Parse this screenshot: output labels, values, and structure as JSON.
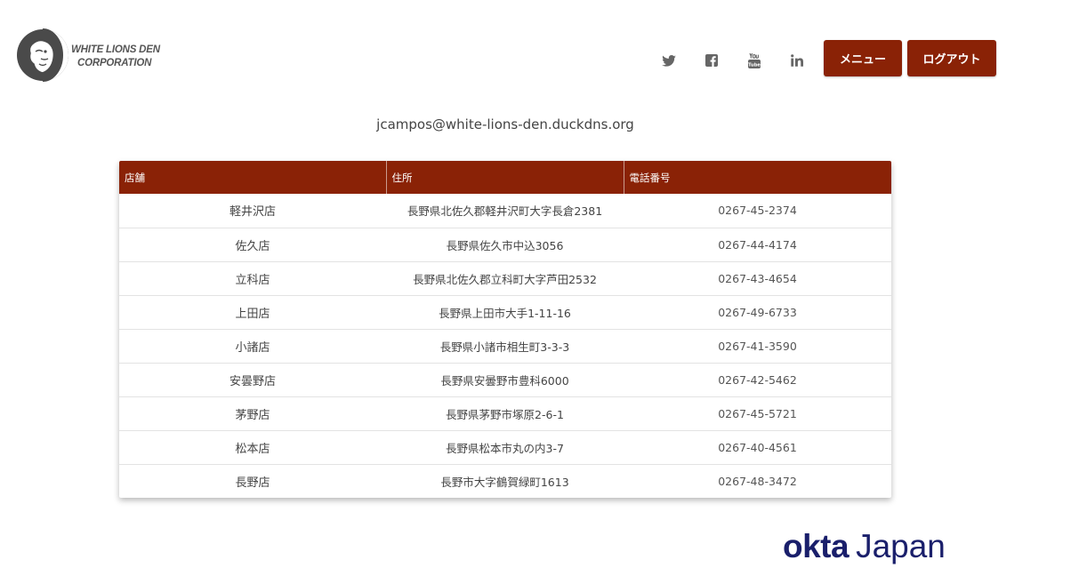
{
  "logo": {
    "line1": "WHITE LIONS DEN",
    "line2": "CORPORATION",
    "icon": "lion-head-logo"
  },
  "social_icons": [
    "twitter-icon",
    "facebook-icon",
    "youtube-icon",
    "linkedin-icon"
  ],
  "header": {
    "menu_label": "メニュー",
    "logout_label": "ログアウト"
  },
  "user": {
    "email": "jcampos@white-lions-den.duckdns.org"
  },
  "table": {
    "columns": [
      "店舗",
      "住所",
      "電話番号"
    ],
    "rows": [
      [
        "軽井沢店",
        "長野県北佐久郡軽井沢町大字長倉2381",
        "0267-45-2374"
      ],
      [
        "佐久店",
        "長野県佐久市中込3056",
        "0267-44-4174"
      ],
      [
        "立科店",
        "長野県北佐久郡立科町大字芦田2532",
        "0267-43-4654"
      ],
      [
        "上田店",
        "長野県上田市大手1-11-16",
        "0267-49-6733"
      ],
      [
        "小諸店",
        "長野県小諸市相生町3-3-3",
        "0267-41-3590"
      ],
      [
        "安曇野店",
        "長野県安曇野市豊科6000",
        "0267-42-5462"
      ],
      [
        "茅野店",
        "長野県茅野市塚原2-6-1",
        "0267-45-5721"
      ],
      [
        "松本店",
        "長野県松本市丸の内3-7",
        "0267-40-4561"
      ],
      [
        "長野店",
        "長野市大字鶴賀緑町1613",
        "0267-48-3472"
      ]
    ]
  },
  "footer_logo": {
    "brand": "okta",
    "suffix": "Japan"
  },
  "colors": {
    "accent": "#8a2206",
    "okta_navy": "#1a1f6b"
  }
}
